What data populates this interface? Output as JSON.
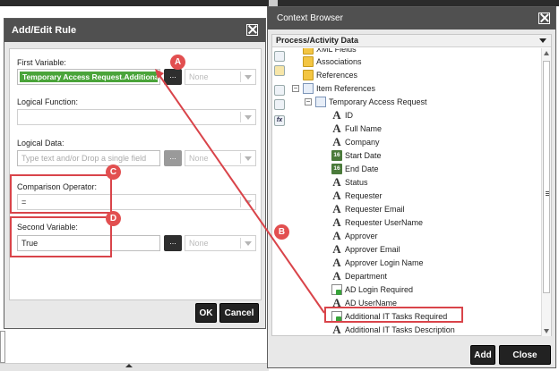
{
  "rule_dialog": {
    "title": "Add/Edit Rule",
    "first_variable_label": "First Variable:",
    "first_variable_value": "Temporary Access Request.Additional IT Tasks Required",
    "first_variable_dd": "None",
    "logical_function_label": "Logical Function:",
    "logical_data_label": "Logical Data:",
    "logical_data_placeholder": "Type text and/or Drop a single field",
    "logical_data_dd": "None",
    "comparison_label": "Comparison Operator:",
    "comparison_value": "=",
    "second_variable_label": "Second Variable:",
    "second_variable_value": "True",
    "second_variable_dd": "None",
    "ellipsis": "...",
    "ok_label": "OK",
    "cancel_label": "Cancel"
  },
  "context_browser": {
    "title": "Context Browser",
    "section": "Process/Activity Data",
    "add_label": "Add",
    "close_label": "Close",
    "tree": [
      {
        "label": "XML Fields",
        "icon": "folder"
      },
      {
        "label": "Associations",
        "icon": "folder-check"
      },
      {
        "label": "References",
        "icon": "folder-check"
      },
      {
        "label": "Item References",
        "icon": "reference"
      },
      {
        "label": "Temporary Access Request",
        "icon": "reference"
      },
      {
        "label": "ID",
        "icon": "text"
      },
      {
        "label": "Full Name",
        "icon": "text"
      },
      {
        "label": "Company",
        "icon": "text"
      },
      {
        "label": "Start Date",
        "icon": "date"
      },
      {
        "label": "End Date",
        "icon": "date"
      },
      {
        "label": "Status",
        "icon": "text"
      },
      {
        "label": "Requester",
        "icon": "text"
      },
      {
        "label": "Requester Email",
        "icon": "text"
      },
      {
        "label": "Requester UserName",
        "icon": "text"
      },
      {
        "label": "Approver",
        "icon": "text"
      },
      {
        "label": "Approver Email",
        "icon": "text"
      },
      {
        "label": "Approver Login Name",
        "icon": "text"
      },
      {
        "label": "Department",
        "icon": "text"
      },
      {
        "label": "AD Login Required",
        "icon": "checkbox"
      },
      {
        "label": "AD UserName",
        "icon": "text"
      },
      {
        "label": "Additional IT Tasks Required",
        "icon": "checkbox"
      },
      {
        "label": "Additional IT Tasks Description",
        "icon": "text"
      },
      {
        "label": "16",
        "icon": "date"
      }
    ],
    "tree_toggles": {
      "collapse": "−"
    },
    "date_icon_text": "16",
    "text_icon_glyph": "A",
    "fx_label": "fx"
  },
  "annotations": {
    "colors": {
      "callout": "#d9444a",
      "badge": "#e24f50"
    },
    "badges": [
      "A",
      "B",
      "C",
      "D"
    ]
  }
}
